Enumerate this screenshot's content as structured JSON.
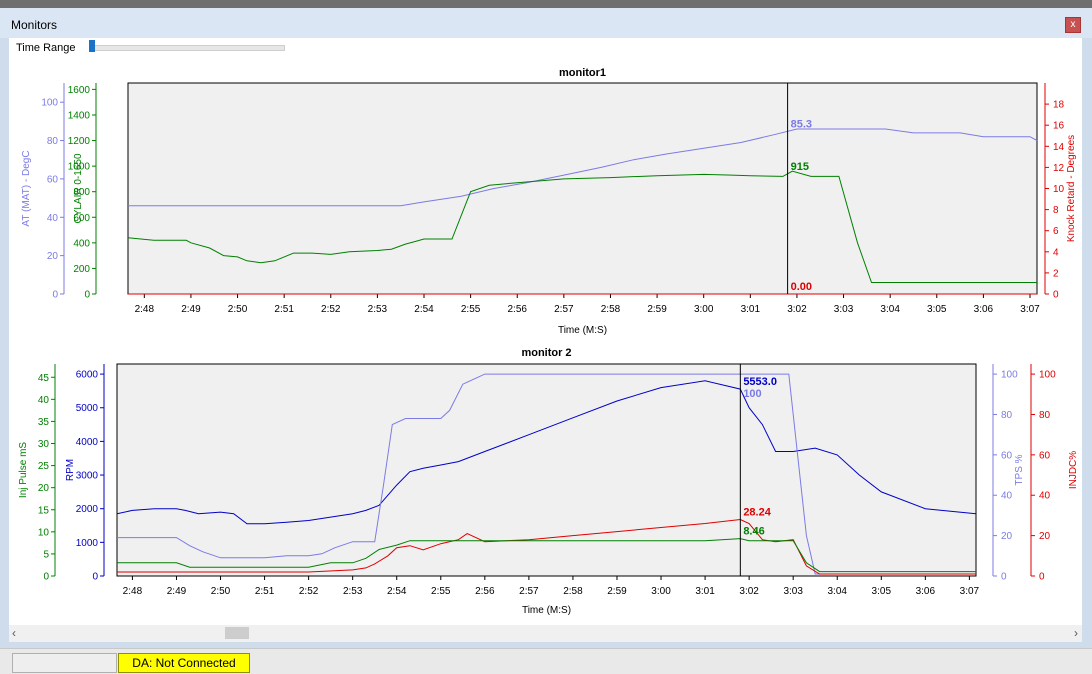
{
  "window": {
    "title": "Monitors",
    "close_label": "x"
  },
  "controls": {
    "time_range_label": "Time Range",
    "time_range_value": 0.0
  },
  "status": {
    "da": "DA: Not Connected"
  },
  "colors": {
    "ice": "#7b7be6",
    "cylair": "#008000",
    "knock": "#e00000",
    "rpm": "#0000c8",
    "tps": "#7b7be6",
    "injdc": "#e00000",
    "injpulse": "#008000",
    "cursor": "#000000",
    "plot_bg": "#f0f0f0"
  },
  "chart_data": [
    {
      "type": "line",
      "title": "monitor1",
      "xlabel": "Time (M:S)",
      "x_ticks": [
        "2:48",
        "2:49",
        "2:50",
        "2:51",
        "2:52",
        "2:53",
        "2:54",
        "2:55",
        "2:56",
        "2:57",
        "2:58",
        "2:59",
        "3:00",
        "3:01",
        "3:02",
        "3:03",
        "3:04",
        "3:05",
        "3:06",
        "3:07"
      ],
      "xlim": [
        167.65,
        187.15
      ],
      "cursor_x": 181.8,
      "axes": [
        {
          "label": "AT (MAT) - DegC",
          "side": "left",
          "ylim": [
            0,
            110
          ],
          "ticks": [
            0,
            20,
            40,
            60,
            80,
            100
          ],
          "color": "#7b7be6"
        },
        {
          "label": "CYLAIR 0-1650",
          "side": "left",
          "ylim": [
            0,
            1650
          ],
          "ticks": [
            0,
            200,
            400,
            600,
            800,
            1000,
            1200,
            1400,
            1600
          ],
          "color": "#008000"
        },
        {
          "label": "Knock Retard - Degrees",
          "side": "right",
          "ylim": [
            0,
            20
          ],
          "ticks": [
            0,
            2,
            4,
            6,
            8,
            10,
            12,
            14,
            16,
            18
          ],
          "color": "#e00000"
        }
      ],
      "series": [
        {
          "axis": 0,
          "color": "#7b7be6",
          "cursor_value": "85.3",
          "x": [
            167.65,
            173.5,
            174.0,
            174.8,
            175.5,
            176.2,
            177.0,
            177.8,
            178.5,
            179.2,
            180.0,
            180.8,
            181.5,
            182.0,
            183.0,
            183.9,
            184.5,
            185.0,
            185.5,
            186.0,
            187.0,
            187.15
          ],
          "y": [
            46,
            46,
            48,
            51,
            55,
            58,
            62,
            66,
            70,
            73,
            76,
            79,
            83,
            86,
            86,
            86,
            84,
            84,
            84,
            82,
            82,
            80
          ]
        },
        {
          "axis": 1,
          "color": "#008000",
          "cursor_value": "915",
          "x": [
            167.65,
            168.2,
            168.4,
            168.9,
            169.0,
            169.4,
            169.7,
            170.0,
            170.2,
            170.5,
            170.8,
            171.2,
            171.6,
            172.0,
            172.4,
            173.0,
            173.3,
            173.6,
            173.8,
            174.0,
            174.3,
            174.6,
            175.0,
            175.4,
            176.0,
            177.0,
            178.0,
            179.0,
            180.0,
            180.6,
            181.0,
            181.7,
            181.9,
            182.3,
            182.9,
            183.3,
            183.6,
            184.2,
            184.6,
            186.0,
            187.15
          ],
          "y": [
            440,
            420,
            420,
            420,
            400,
            360,
            300,
            290,
            260,
            245,
            260,
            320,
            320,
            310,
            330,
            340,
            350,
            390,
            410,
            430,
            430,
            430,
            800,
            850,
            870,
            900,
            910,
            925,
            935,
            930,
            925,
            920,
            960,
            920,
            920,
            400,
            90,
            90,
            90,
            90,
            90
          ]
        },
        {
          "axis": 2,
          "color": "#e00000",
          "cursor_value": "0.00",
          "x": [
            167.65,
            187.15
          ],
          "y": [
            0,
            0
          ]
        }
      ]
    },
    {
      "type": "line",
      "title": "monitor 2",
      "xlabel": "Time (M:S)",
      "x_ticks": [
        "2:48",
        "2:49",
        "2:50",
        "2:51",
        "2:52",
        "2:53",
        "2:54",
        "2:55",
        "2:56",
        "2:57",
        "2:58",
        "2:59",
        "3:00",
        "3:01",
        "3:02",
        "3:03",
        "3:04",
        "3:05",
        "3:06",
        "3:07"
      ],
      "xlim": [
        167.65,
        187.15
      ],
      "cursor_x": 181.8,
      "axes": [
        {
          "label": "Inj Pulse mS",
          "side": "left",
          "ylim": [
            0,
            48
          ],
          "ticks": [
            0,
            5,
            10,
            15,
            20,
            25,
            30,
            35,
            40,
            45
          ],
          "color": "#008000"
        },
        {
          "label": "RPM",
          "side": "left",
          "ylim": [
            0,
            6300
          ],
          "ticks": [
            0,
            1000,
            2000,
            3000,
            4000,
            5000,
            6000
          ],
          "color": "#0000c8"
        },
        {
          "label": "TPS %",
          "side": "right",
          "ylim": [
            0,
            105
          ],
          "ticks": [
            0,
            20,
            40,
            60,
            80,
            100
          ],
          "color": "#7b7be6"
        },
        {
          "label": "INJDC%",
          "side": "right",
          "ylim": [
            0,
            105
          ],
          "ticks": [
            0,
            20,
            40,
            60,
            80,
            100
          ],
          "color": "#e00000"
        }
      ],
      "series": [
        {
          "axis": 1,
          "color": "#0000c8",
          "cursor_value": "5553.0",
          "x": [
            167.65,
            168.0,
            168.5,
            169.0,
            169.2,
            169.5,
            170.0,
            170.3,
            170.6,
            171.0,
            171.5,
            172.0,
            172.5,
            173.0,
            173.3,
            173.6,
            174.0,
            174.3,
            174.6,
            175.0,
            175.4,
            176.0,
            177.0,
            178.0,
            179.0,
            180.0,
            181.0,
            181.8,
            182.0,
            182.3,
            182.6,
            183.0,
            183.5,
            184.0,
            184.5,
            185.0,
            186.0,
            187.15
          ],
          "y": [
            1850,
            1950,
            2000,
            2000,
            1950,
            1850,
            1900,
            1850,
            1550,
            1550,
            1600,
            1650,
            1750,
            1850,
            1950,
            2100,
            2700,
            3100,
            3200,
            3300,
            3400,
            3700,
            4200,
            4700,
            5200,
            5600,
            5800,
            5553,
            5000,
            4500,
            3700,
            3700,
            3800,
            3600,
            3000,
            2500,
            2000,
            1850
          ]
        },
        {
          "axis": 2,
          "color": "#7b7be6",
          "cursor_value": "100",
          "x": [
            167.65,
            168.0,
            168.5,
            169.0,
            169.3,
            169.6,
            170.0,
            170.5,
            171.0,
            171.5,
            172.0,
            172.3,
            172.6,
            173.0,
            173.3,
            173.5,
            173.7,
            173.9,
            174.2,
            174.6,
            175.0,
            175.2,
            175.5,
            176.0,
            177.0,
            178.0,
            179.0,
            180.0,
            181.0,
            181.8,
            182.0,
            182.5,
            182.9,
            183.1,
            183.3,
            183.5,
            184.0,
            185.0,
            186.0,
            187.15
          ],
          "y": [
            19,
            19,
            19,
            19,
            15,
            12,
            9,
            9,
            9,
            10,
            10,
            11,
            14,
            17,
            17,
            17,
            45,
            75,
            78,
            78,
            78,
            82,
            95,
            100,
            100,
            100,
            100,
            100,
            100,
            100,
            100,
            100,
            100,
            60,
            20,
            1,
            1,
            1,
            1,
            1
          ]
        },
        {
          "axis": 3,
          "color": "#e00000",
          "cursor_value": "28.24",
          "x": [
            167.65,
            168.0,
            169.0,
            170.0,
            171.0,
            172.0,
            173.0,
            173.3,
            173.5,
            173.8,
            174.0,
            174.3,
            174.6,
            175.0,
            175.4,
            175.6,
            176.0,
            177.0,
            178.0,
            179.0,
            180.0,
            181.0,
            181.8,
            182.0,
            182.3,
            182.6,
            183.0,
            183.3,
            183.6,
            184.0,
            187.15
          ],
          "y": [
            2,
            2,
            2,
            2,
            2,
            2,
            3,
            4,
            6,
            10,
            14,
            15,
            13,
            16,
            18,
            21,
            17,
            18,
            20,
            22,
            24,
            26,
            28,
            26,
            18,
            17,
            18,
            5,
            1,
            1,
            1
          ]
        },
        {
          "axis": 0,
          "color": "#008000",
          "cursor_value": "8.46",
          "x": [
            167.65,
            168.0,
            169.0,
            169.3,
            170.0,
            170.5,
            171.0,
            171.5,
            172.0,
            172.5,
            173.0,
            173.3,
            173.6,
            174.0,
            174.3,
            174.6,
            175.0,
            175.4,
            175.6,
            176.0,
            177.0,
            178.0,
            179.0,
            180.0,
            181.0,
            181.8,
            182.0,
            183.0,
            183.3,
            183.6,
            184.0,
            187.15
          ],
          "y": [
            3,
            3,
            3,
            2,
            2,
            2,
            2,
            2,
            2,
            3,
            3,
            4,
            6,
            7,
            8,
            8,
            8,
            8,
            8,
            8,
            8,
            8,
            8,
            8,
            8,
            8.46,
            8,
            8,
            3,
            1,
            1,
            1
          ]
        }
      ]
    }
  ]
}
